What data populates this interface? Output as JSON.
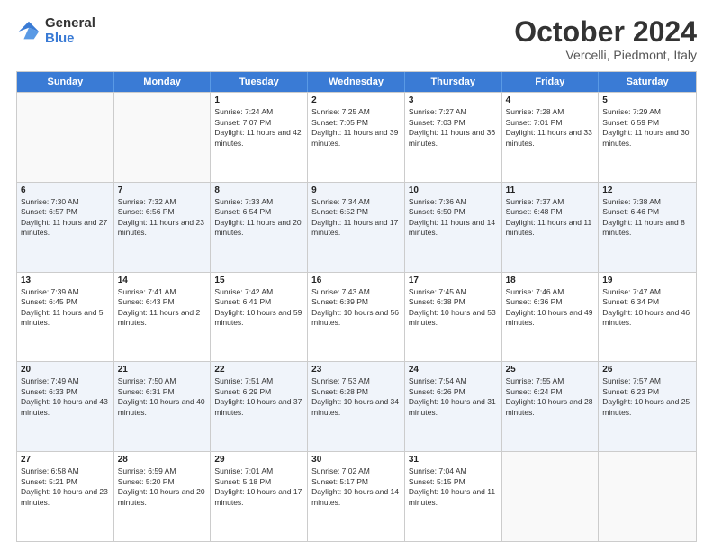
{
  "logo": {
    "general": "General",
    "blue": "Blue"
  },
  "title": "October 2024",
  "subtitle": "Vercelli, Piedmont, Italy",
  "days": [
    "Sunday",
    "Monday",
    "Tuesday",
    "Wednesday",
    "Thursday",
    "Friday",
    "Saturday"
  ],
  "weeks": [
    [
      {
        "day": "",
        "sunrise": "",
        "sunset": "",
        "daylight": ""
      },
      {
        "day": "",
        "sunrise": "",
        "sunset": "",
        "daylight": ""
      },
      {
        "day": "1",
        "sunrise": "Sunrise: 7:24 AM",
        "sunset": "Sunset: 7:07 PM",
        "daylight": "Daylight: 11 hours and 42 minutes."
      },
      {
        "day": "2",
        "sunrise": "Sunrise: 7:25 AM",
        "sunset": "Sunset: 7:05 PM",
        "daylight": "Daylight: 11 hours and 39 minutes."
      },
      {
        "day": "3",
        "sunrise": "Sunrise: 7:27 AM",
        "sunset": "Sunset: 7:03 PM",
        "daylight": "Daylight: 11 hours and 36 minutes."
      },
      {
        "day": "4",
        "sunrise": "Sunrise: 7:28 AM",
        "sunset": "Sunset: 7:01 PM",
        "daylight": "Daylight: 11 hours and 33 minutes."
      },
      {
        "day": "5",
        "sunrise": "Sunrise: 7:29 AM",
        "sunset": "Sunset: 6:59 PM",
        "daylight": "Daylight: 11 hours and 30 minutes."
      }
    ],
    [
      {
        "day": "6",
        "sunrise": "Sunrise: 7:30 AM",
        "sunset": "Sunset: 6:57 PM",
        "daylight": "Daylight: 11 hours and 27 minutes."
      },
      {
        "day": "7",
        "sunrise": "Sunrise: 7:32 AM",
        "sunset": "Sunset: 6:56 PM",
        "daylight": "Daylight: 11 hours and 23 minutes."
      },
      {
        "day": "8",
        "sunrise": "Sunrise: 7:33 AM",
        "sunset": "Sunset: 6:54 PM",
        "daylight": "Daylight: 11 hours and 20 minutes."
      },
      {
        "day": "9",
        "sunrise": "Sunrise: 7:34 AM",
        "sunset": "Sunset: 6:52 PM",
        "daylight": "Daylight: 11 hours and 17 minutes."
      },
      {
        "day": "10",
        "sunrise": "Sunrise: 7:36 AM",
        "sunset": "Sunset: 6:50 PM",
        "daylight": "Daylight: 11 hours and 14 minutes."
      },
      {
        "day": "11",
        "sunrise": "Sunrise: 7:37 AM",
        "sunset": "Sunset: 6:48 PM",
        "daylight": "Daylight: 11 hours and 11 minutes."
      },
      {
        "day": "12",
        "sunrise": "Sunrise: 7:38 AM",
        "sunset": "Sunset: 6:46 PM",
        "daylight": "Daylight: 11 hours and 8 minutes."
      }
    ],
    [
      {
        "day": "13",
        "sunrise": "Sunrise: 7:39 AM",
        "sunset": "Sunset: 6:45 PM",
        "daylight": "Daylight: 11 hours and 5 minutes."
      },
      {
        "day": "14",
        "sunrise": "Sunrise: 7:41 AM",
        "sunset": "Sunset: 6:43 PM",
        "daylight": "Daylight: 11 hours and 2 minutes."
      },
      {
        "day": "15",
        "sunrise": "Sunrise: 7:42 AM",
        "sunset": "Sunset: 6:41 PM",
        "daylight": "Daylight: 10 hours and 59 minutes."
      },
      {
        "day": "16",
        "sunrise": "Sunrise: 7:43 AM",
        "sunset": "Sunset: 6:39 PM",
        "daylight": "Daylight: 10 hours and 56 minutes."
      },
      {
        "day": "17",
        "sunrise": "Sunrise: 7:45 AM",
        "sunset": "Sunset: 6:38 PM",
        "daylight": "Daylight: 10 hours and 53 minutes."
      },
      {
        "day": "18",
        "sunrise": "Sunrise: 7:46 AM",
        "sunset": "Sunset: 6:36 PM",
        "daylight": "Daylight: 10 hours and 49 minutes."
      },
      {
        "day": "19",
        "sunrise": "Sunrise: 7:47 AM",
        "sunset": "Sunset: 6:34 PM",
        "daylight": "Daylight: 10 hours and 46 minutes."
      }
    ],
    [
      {
        "day": "20",
        "sunrise": "Sunrise: 7:49 AM",
        "sunset": "Sunset: 6:33 PM",
        "daylight": "Daylight: 10 hours and 43 minutes."
      },
      {
        "day": "21",
        "sunrise": "Sunrise: 7:50 AM",
        "sunset": "Sunset: 6:31 PM",
        "daylight": "Daylight: 10 hours and 40 minutes."
      },
      {
        "day": "22",
        "sunrise": "Sunrise: 7:51 AM",
        "sunset": "Sunset: 6:29 PM",
        "daylight": "Daylight: 10 hours and 37 minutes."
      },
      {
        "day": "23",
        "sunrise": "Sunrise: 7:53 AM",
        "sunset": "Sunset: 6:28 PM",
        "daylight": "Daylight: 10 hours and 34 minutes."
      },
      {
        "day": "24",
        "sunrise": "Sunrise: 7:54 AM",
        "sunset": "Sunset: 6:26 PM",
        "daylight": "Daylight: 10 hours and 31 minutes."
      },
      {
        "day": "25",
        "sunrise": "Sunrise: 7:55 AM",
        "sunset": "Sunset: 6:24 PM",
        "daylight": "Daylight: 10 hours and 28 minutes."
      },
      {
        "day": "26",
        "sunrise": "Sunrise: 7:57 AM",
        "sunset": "Sunset: 6:23 PM",
        "daylight": "Daylight: 10 hours and 25 minutes."
      }
    ],
    [
      {
        "day": "27",
        "sunrise": "Sunrise: 6:58 AM",
        "sunset": "Sunset: 5:21 PM",
        "daylight": "Daylight: 10 hours and 23 minutes."
      },
      {
        "day": "28",
        "sunrise": "Sunrise: 6:59 AM",
        "sunset": "Sunset: 5:20 PM",
        "daylight": "Daylight: 10 hours and 20 minutes."
      },
      {
        "day": "29",
        "sunrise": "Sunrise: 7:01 AM",
        "sunset": "Sunset: 5:18 PM",
        "daylight": "Daylight: 10 hours and 17 minutes."
      },
      {
        "day": "30",
        "sunrise": "Sunrise: 7:02 AM",
        "sunset": "Sunset: 5:17 PM",
        "daylight": "Daylight: 10 hours and 14 minutes."
      },
      {
        "day": "31",
        "sunrise": "Sunrise: 7:04 AM",
        "sunset": "Sunset: 5:15 PM",
        "daylight": "Daylight: 10 hours and 11 minutes."
      },
      {
        "day": "",
        "sunrise": "",
        "sunset": "",
        "daylight": ""
      },
      {
        "day": "",
        "sunrise": "",
        "sunset": "",
        "daylight": ""
      }
    ]
  ]
}
